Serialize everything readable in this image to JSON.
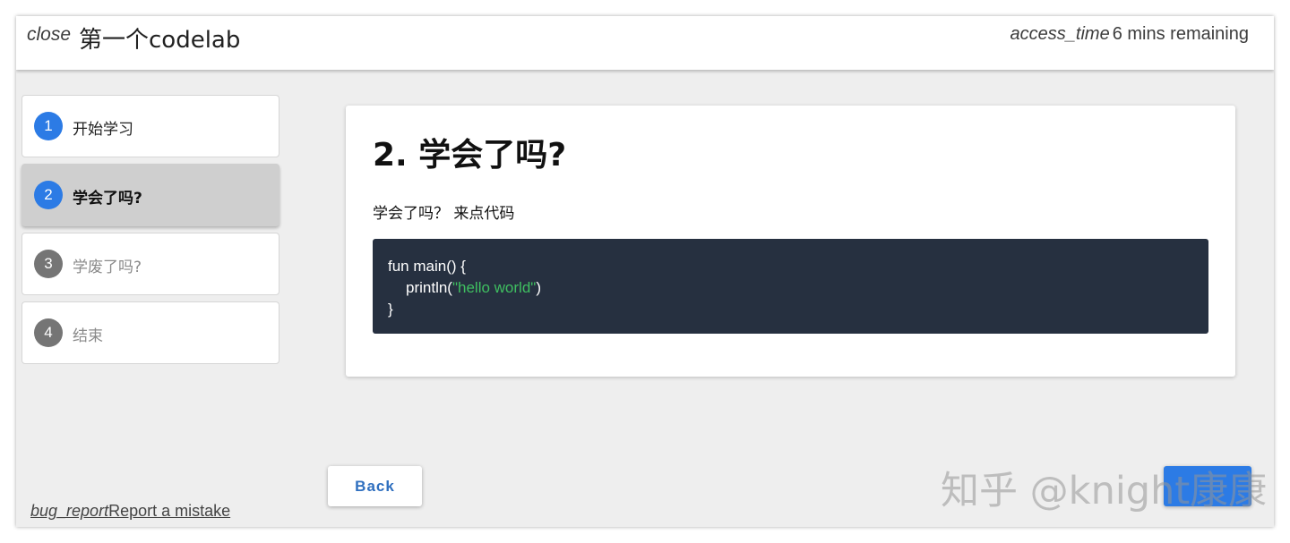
{
  "topbar": {
    "close_icon": "close",
    "title": "第一个codelab",
    "time_icon": "access_time",
    "time_remaining": "6 mins remaining"
  },
  "steps": [
    {
      "number": "1",
      "label": "开始学习",
      "state": "done"
    },
    {
      "number": "2",
      "label": "学会了吗?",
      "state": "active"
    },
    {
      "number": "3",
      "label": "学废了吗?",
      "state": "todo"
    },
    {
      "number": "4",
      "label": "结束",
      "state": "todo"
    }
  ],
  "content": {
    "title": "2. 学会了吗?",
    "text": "学会了吗？ 来点代码",
    "code": {
      "line1": "fun main() {",
      "line2_prefix": "println(",
      "line2_string": "\"hello world\"",
      "line2_suffix": ")",
      "line3": "}"
    }
  },
  "footer": {
    "back_label": "Back",
    "bug_icon": "bug_report",
    "report_label": "Report a mistake",
    "watermark": "知乎 @knight康康"
  },
  "colors": {
    "accent": "#2c7be5",
    "step_done": "#2c7be5",
    "step_active": "#2c7be5",
    "step_todo": "#757575",
    "code_bg": "#263040",
    "code_string": "#3fbf60"
  }
}
